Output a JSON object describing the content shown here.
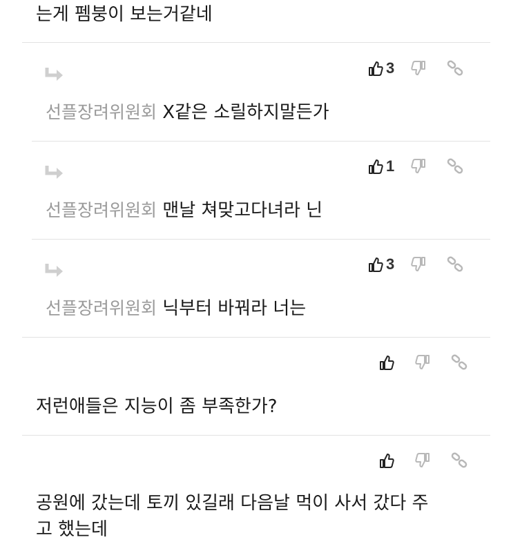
{
  "top_comment": {
    "text": "는게 펨붕이 보는거같네"
  },
  "replies": [
    {
      "author": "선플장려위원회",
      "text": "X같은 소릴하지말든가",
      "upvotes": "3"
    },
    {
      "author": "선플장려위원회",
      "text": "맨날 쳐맞고다녀라 닌",
      "upvotes": "1"
    },
    {
      "author": "선플장려위원회",
      "text": "닉부터 바꿔라 너는",
      "upvotes": "3"
    }
  ],
  "comments": [
    {
      "text": "저런애들은 지능이 좀 부족한가?",
      "upvotes": ""
    },
    {
      "text_line1": "공원에 갔는데 토끼 있길래 다음날 먹이 사서 갔다 주",
      "text_line2": "고 했는데",
      "upvotes": ""
    }
  ],
  "icons": {
    "upvote": "thumbs-up-icon",
    "downvote": "thumbs-down-icon",
    "link": "link-icon",
    "reply": "reply-arrow-icon"
  },
  "colors": {
    "author": "#9a9a9a",
    "reply_arrow": "#cfcfcf",
    "icon_gray": "#b8b8b8",
    "divider": "#e2e2e2"
  }
}
